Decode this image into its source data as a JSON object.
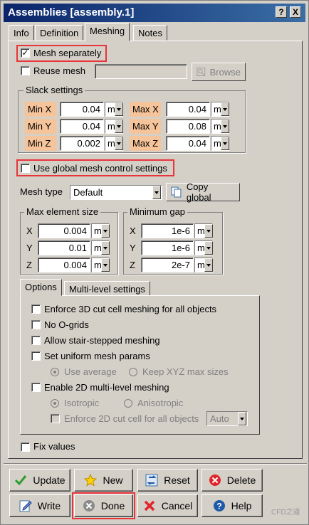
{
  "window": {
    "title": "Assemblies [assembly.1]"
  },
  "titlebar": {
    "help_glyph": "?",
    "close_glyph": "X"
  },
  "tabs": [
    {
      "label": "Info"
    },
    {
      "label": "Definition"
    },
    {
      "label": "Meshing",
      "active": true
    },
    {
      "label": "Notes"
    }
  ],
  "mesh_separately": {
    "label": "Mesh separately",
    "checked": true
  },
  "reuse_mesh": {
    "label": "Reuse mesh",
    "checked": false,
    "value": "",
    "browse_label": "Browse"
  },
  "slack": {
    "title": "Slack settings",
    "min_x": {
      "label": "Min X",
      "value": "0.04",
      "unit": "m"
    },
    "min_y": {
      "label": "Min Y",
      "value": "0.04",
      "unit": "m"
    },
    "min_z": {
      "label": "Min Z",
      "value": "0.002",
      "unit": "m"
    },
    "max_x": {
      "label": "Max X",
      "value": "0.04",
      "unit": "m"
    },
    "max_y": {
      "label": "Max Y",
      "value": "0.08",
      "unit": "m"
    },
    "max_z": {
      "label": "Max Z",
      "value": "0.04",
      "unit": "m"
    }
  },
  "use_global": {
    "label": "Use global mesh control settings",
    "checked": false
  },
  "mesh_type": {
    "label": "Mesh type",
    "value": "Default",
    "copy_label": "Copy global"
  },
  "max_element": {
    "title": "Max element size",
    "x": {
      "label": "X",
      "value": "0.004",
      "unit": "m"
    },
    "y": {
      "label": "Y",
      "value": "0.01",
      "unit": "m"
    },
    "z": {
      "label": "Z",
      "value": "0.004",
      "unit": "m"
    }
  },
  "min_gap": {
    "title": "Minimum gap",
    "x": {
      "label": "X",
      "value": "1e-6",
      "unit": "m"
    },
    "y": {
      "label": "Y",
      "value": "1e-6",
      "unit": "m"
    },
    "z": {
      "label": "Z",
      "value": "2e-7",
      "unit": "m"
    }
  },
  "subtabs": [
    {
      "label": "Options",
      "active": true
    },
    {
      "label": "Multi-level settings"
    }
  ],
  "options": {
    "enforce_3d": "Enforce 3D cut cell meshing for all objects",
    "no_ogrids": "No O-grids",
    "stair": "Allow stair-stepped meshing",
    "uniform": "Set uniform mesh params",
    "use_average": "Use average",
    "keep_xyz": "Keep XYZ max sizes",
    "enable_2d": "Enable 2D multi-level meshing",
    "isotropic": "Isotropic",
    "anisotropic": "Anisotropic",
    "enforce_2d": "Enforce 2D cut cell for all objects",
    "enforce_2d_mode": "Auto"
  },
  "fix_values": {
    "label": "Fix values",
    "checked": false
  },
  "buttons": {
    "update": "Update",
    "new": "New",
    "reset": "Reset",
    "delete": "Delete",
    "write": "Write",
    "done": "Done",
    "cancel": "Cancel",
    "help": "Help"
  },
  "watermark": {
    "text": "CFD之道"
  },
  "colors": {
    "highlight": "#e8343a",
    "label_bg": "#f6c49a",
    "title_bar": "#0a246a"
  }
}
